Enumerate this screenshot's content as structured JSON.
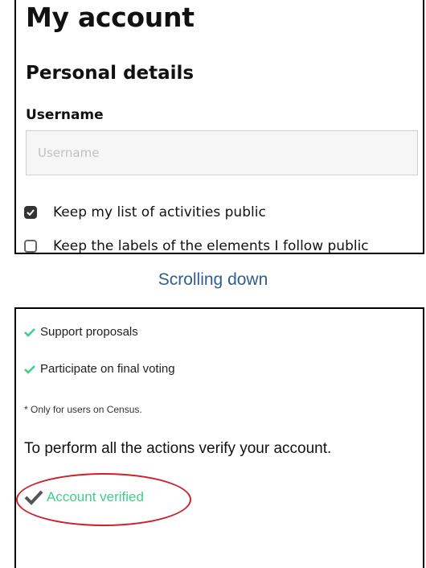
{
  "account": {
    "title": "My account",
    "section": "Personal details",
    "username_label": "Username",
    "username_placeholder": "Username",
    "username_value": "",
    "options": [
      {
        "label": "Keep my list of activities public",
        "checked": true
      },
      {
        "label": "Keep the labels of the elements I follow public",
        "checked": false
      }
    ]
  },
  "caption": "Scrolling down",
  "verification": {
    "permissions": [
      {
        "label": "Support proposals",
        "icon": "check-icon"
      },
      {
        "label": "Participate on final voting",
        "icon": "check-icon"
      }
    ],
    "note": "* Only for users on Census.",
    "instruction": "To perform all the actions verify your account.",
    "status": "Account verified",
    "status_color": "#3ecf8e",
    "highlight_color": "#d0202a"
  }
}
